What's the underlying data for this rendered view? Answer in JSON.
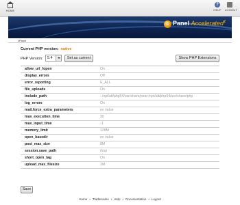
{
  "topbar": {
    "home_label": "HOME",
    "help_label": "HELP",
    "logout_label": "LOGOUT"
  },
  "banner": {
    "logo_mark": "c",
    "logo_brand": "Panel",
    "logo_product": "Accelerated",
    "logo_version": "2"
  },
  "breadcrumb": "cPanel",
  "current_version": {
    "label": "Current PHP version:",
    "value": "native"
  },
  "php_version": {
    "label": "PHP Version:",
    "selected": "5.4",
    "set_current_label": "Set as current",
    "show_extensions_label": "Show PHP Extensions"
  },
  "settings": [
    {
      "key": "allow_url_fopen",
      "value": "On"
    },
    {
      "key": "display_errors",
      "value": "Off"
    },
    {
      "key": "error_reporting",
      "value": "E_ALL"
    },
    {
      "key": "file_uploads",
      "value": "On"
    },
    {
      "key": "include_path",
      "value": "../opt/alt/php54/usr/share/pear:/opt/alt/php54/usr/share/php"
    },
    {
      "key": "log_errors",
      "value": "On"
    },
    {
      "key": "mail.force_extra_parameters",
      "value": "no value"
    },
    {
      "key": "max_execution_time",
      "value": "30"
    },
    {
      "key": "max_input_time",
      "value": "-1"
    },
    {
      "key": "memory_limit",
      "value": "128M"
    },
    {
      "key": "open_basedir",
      "value": "no value"
    },
    {
      "key": "post_max_size",
      "value": "8M"
    },
    {
      "key": "session.save_path",
      "value": "/tmp"
    },
    {
      "key": "short_open_tag",
      "value": "On"
    },
    {
      "key": "upload_max_filesize",
      "value": "2M"
    }
  ],
  "save_label": "Save",
  "footer": {
    "links": [
      "Home",
      "Trademarks",
      "Help",
      "Documentation",
      "Logout"
    ]
  },
  "colors": {
    "banner_dark": "#0e2450",
    "accent_orange": "#e07b00",
    "value_gray": "#9a9a9a"
  }
}
